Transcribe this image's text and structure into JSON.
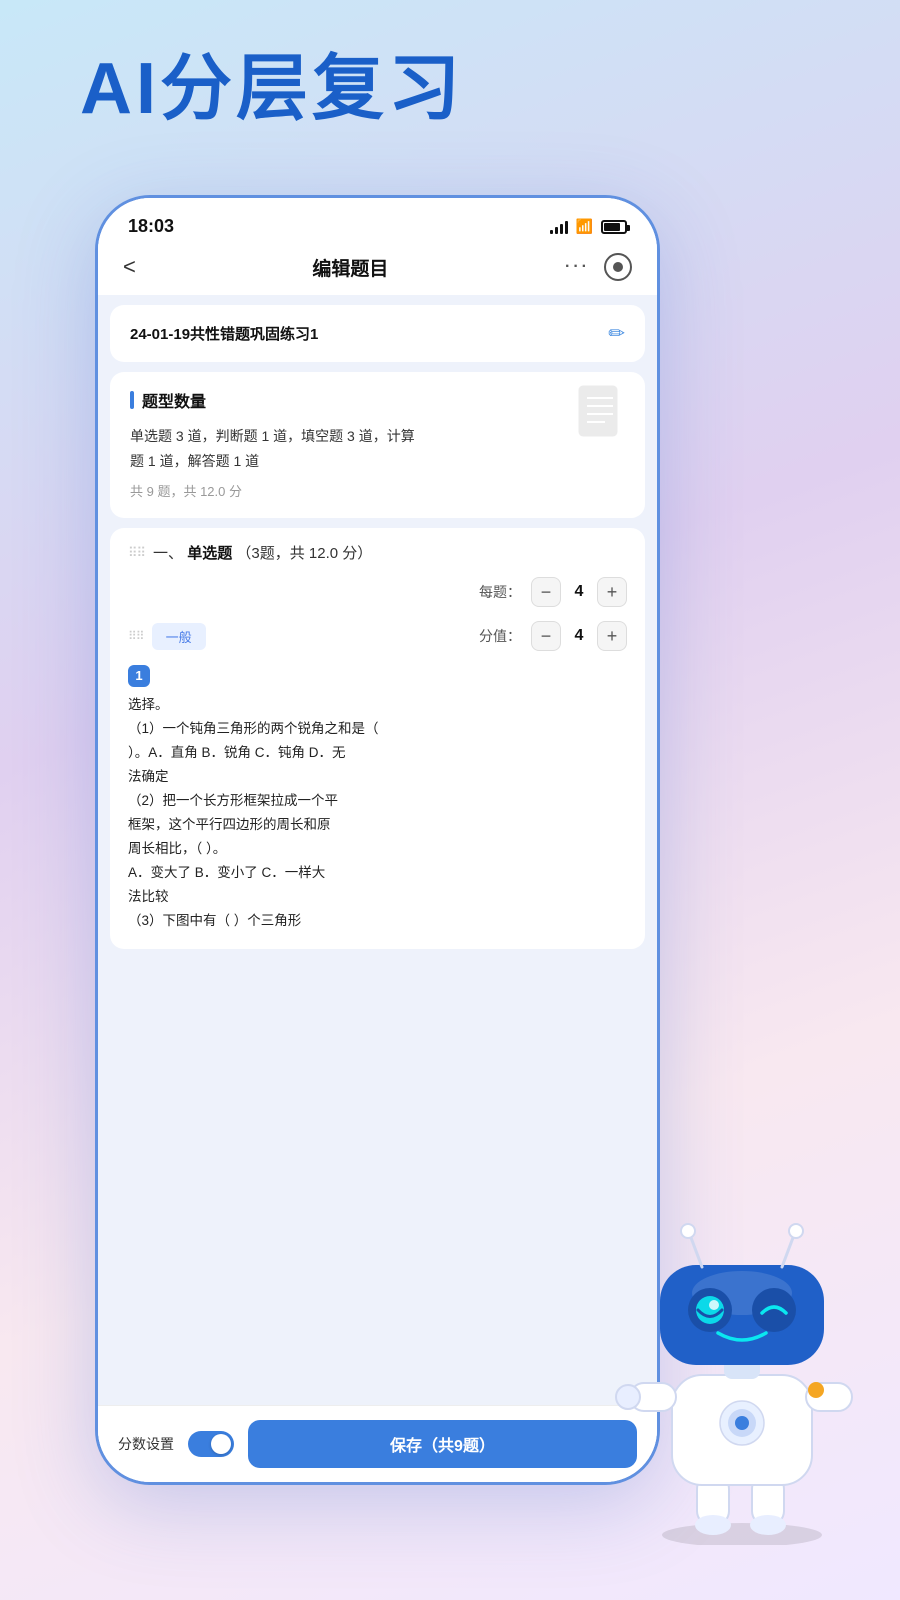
{
  "page": {
    "title": "AI分层复习",
    "status_time": "18:03"
  },
  "nav": {
    "back_label": "<",
    "title": "编辑题目",
    "more": "···",
    "record": ""
  },
  "title_card": {
    "text": "24-01-19共性错题巩固练习1",
    "edit_icon": "✏"
  },
  "qtype_section": {
    "title": "题型数量",
    "description": "单选题 3 道，判断题 1 道，填空题 3 道，计算\n题 1 道，解答题 1 道",
    "total": "共 9 题，共 12.0 分"
  },
  "section_one": {
    "label": "一、",
    "type": "单选题",
    "count": "（3题，共 12.0 分）",
    "per_score_label": "每题：",
    "per_score_value": "4",
    "sub_items": [
      {
        "tag": "一般",
        "score_label": "分值：",
        "score_value": "4"
      }
    ]
  },
  "question_1": {
    "number": "1",
    "prefix": "选择。",
    "content": "（1）一个钝角三角形的两个锐角之和是（\n）。A．直角  B．锐角  C．钝角  D．无\n法确定\n（2）把一个长方形框架拉成一个平\n框架，这个平行四边形的周长和原\n周长相比，（  ）。\nA．变大了  B．变小了  C．一样大\n法比较\n（3）下图中有（  ）个三角形"
  },
  "bottom": {
    "score_setting_label": "分数设置",
    "save_label": "保存（共9题）"
  }
}
